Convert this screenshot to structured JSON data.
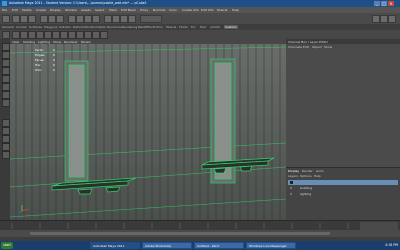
{
  "window": {
    "title": "Autodesk Maya 2011 - Student Version: C:\\Users\\…\\scenes\\castle_wall.mb* --- pCube1",
    "min": "_",
    "max": "□",
    "close": "×"
  },
  "menubar": {
    "items": [
      "File",
      "Edit",
      "Modify",
      "Create",
      "Display",
      "Window",
      "Assets",
      "Select",
      "Mesh",
      "Edit Mesh",
      "Proxy",
      "Normals",
      "Color",
      "Create UVs",
      "Edit UVs",
      "Muscle",
      "Help"
    ]
  },
  "tabs": [
    "General",
    "Curves",
    "Surfaces",
    "Polygons",
    "Subdivs",
    "Deformation",
    "Animation",
    "Dynamics",
    "Rendering",
    "PaintEffects",
    "Toon",
    "Muscle",
    "Fluids",
    "Fur",
    "Hair",
    "nCloth",
    "Custom"
  ],
  "viewport": {
    "menu": [
      "View",
      "Shading",
      "Lighting",
      "Show",
      "Renderer",
      "Panels"
    ],
    "hud": [
      {
        "label": "Verts:",
        "value": "0"
      },
      {
        "label": "Edges:",
        "value": "0"
      },
      {
        "label": "Faces:",
        "value": "0"
      },
      {
        "label": "Tris:",
        "value": "0"
      },
      {
        "label": "UVs:",
        "value": "0"
      }
    ]
  },
  "right_panel": {
    "title": "Channel Box / Layer Editor",
    "menu": [
      "Channels",
      "Edit",
      "Object",
      "Show"
    ],
    "layer_tabs": [
      "Display",
      "Render",
      "Anim"
    ],
    "layer_menu": [
      "Layers",
      "Options",
      "Help"
    ],
    "layers": [
      {
        "v": "V",
        "name": "building"
      },
      {
        "v": "V",
        "name": "lighting"
      }
    ]
  },
  "taskbar": {
    "start": "start",
    "tasks": [
      "Autodesk Maya 2011",
      "Adobe Photoshop",
      "Untitled - Paint",
      "Windows Live Messenger"
    ],
    "clock": "4:18 PM"
  },
  "colors": {
    "wireframe": "#2fd06a",
    "selected_layer": "#6a8fb6"
  }
}
